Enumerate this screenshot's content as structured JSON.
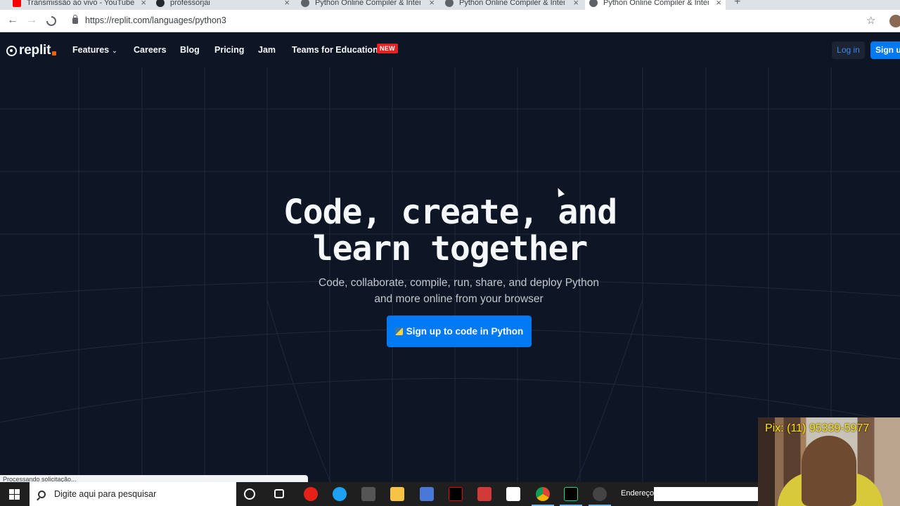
{
  "browser": {
    "tabs": [
      {
        "title": "Transmissão ao vivo - YouTube",
        "favicon_color": "#ff0000"
      },
      {
        "title": "professorjai",
        "favicon_color": "#24292e"
      },
      {
        "title": "Python Online Compiler & Interp",
        "favicon_color": "#5f6368"
      },
      {
        "title": "Python Online Compiler & Interp",
        "favicon_color": "#5f6368"
      },
      {
        "title": "Python Online Compiler & Interp",
        "favicon_color": "#5f6368"
      }
    ],
    "new_tab": "+",
    "url": "https://replit.com/languages/python3",
    "status_text": "Processando solicitação..."
  },
  "navbar": {
    "logo_text": "replit",
    "features": "Features",
    "careers": "Careers",
    "blog": "Blog",
    "pricing": "Pricing",
    "jam": "Jam",
    "teams": "Teams for Education",
    "new_badge": "NEW",
    "login": "Log in",
    "signup": "Sign up"
  },
  "hero": {
    "title_line1": "Code, create, and",
    "title_line2": "learn together",
    "subtitle_line1": "Code, collaborate, compile, run, share, and deploy Python",
    "subtitle_line2": "and more online from your browser",
    "cta": "Sign up to code in Python"
  },
  "taskbar": {
    "search_placeholder": "Digite aqui para pesquisar",
    "address_label": "Endereço"
  },
  "overlay": {
    "pix_text": "Pix: (11) 95339-5977"
  },
  "colors": {
    "page_bg": "#0e1525",
    "accent": "#0079f2",
    "badge": "#e52222"
  }
}
